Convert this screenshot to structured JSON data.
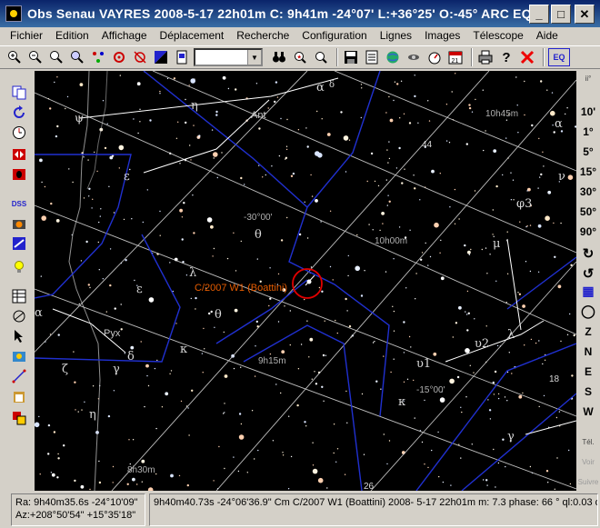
{
  "window": {
    "title": "Obs Senau VAYRES 2008-5-17  22h01m C:  9h41m -24°07' L:+36°25' O:-45° ARC EQ M...",
    "minimize": "_",
    "maximize": "□",
    "close": "✕"
  },
  "menu": [
    "Fichier",
    "Edition",
    "Affichage",
    "Déplacement",
    "Recherche",
    "Configuration",
    "Lignes",
    "Images",
    "Télescope",
    "Aide"
  ],
  "toolbar": {
    "icons": [
      "zoom-in-icon",
      "zoom-out-icon",
      "zoom-fit-icon",
      "find-icon",
      "centre-icon",
      "target-icon",
      "no-target-icon",
      "color-icon",
      "page-icon"
    ],
    "icons_right": [
      "binoculars-icon",
      "search-star-icon",
      "search-object-icon",
      "save-icon",
      "list-icon",
      "globe-icon",
      "satellite-icon",
      "dial-icon",
      "calendar-icon",
      "print-icon",
      "help-icon",
      "exit-icon"
    ],
    "combo_value": "",
    "eq_label": "EQ",
    "help_label": "?",
    "calendar_label": "21"
  },
  "leftbar": {
    "icons": [
      "copy-icon",
      "refresh-icon",
      "clock-icon",
      "flip-icon",
      "bug-icon",
      "dss-icon",
      "camera-icon",
      "telescope-icon",
      "bulb-icon",
      "table-icon",
      "circle-icon",
      "pointer-icon",
      "photo-icon",
      "measure-icon",
      "paste-icon",
      "settings-icon"
    ],
    "dss_label": "DSS"
  },
  "rightbar": {
    "fov": [
      "10'",
      "1°",
      "5°",
      "15°",
      "30°",
      "50°",
      "90°"
    ],
    "directions": [
      "Z",
      "N",
      "E",
      "S",
      "W"
    ],
    "tel_label": "Tél.",
    "voir_label": "Voir",
    "suivre_label": "Suivre",
    "small_label": "ii°"
  },
  "chart": {
    "object_label": "C/2007 W1 (Boattini)",
    "coord_labels": [
      "-30°00'",
      "10h00m",
      "9h15m",
      "-15°00'",
      "10h45m",
      "8h30m"
    ],
    "constellation_labels": [
      "Ant",
      "Pyx"
    ],
    "star_labels": [
      "α",
      "δ",
      "η",
      "ψ",
      "ε",
      "θ",
      "λ",
      "ε",
      "θ",
      "κ",
      "α",
      "δ",
      "γ",
      "ζ",
      "η",
      "μ",
      "φ3",
      "υ2",
      "λ",
      "υ1",
      "κ",
      "γ",
      "α",
      "ν",
      "44",
      "18",
      "26"
    ]
  },
  "status": {
    "ra": "Ra:  9h40m35.6s -24°10'09\"",
    "az": "Az:+208°50'54\" +15°35'18\"",
    "info": "9h40m40.73s -24°06'36.9\"  Cm C/2007 W1 (Boattini) 2008- 5-17  22h01m m:  7.3 phase:  66 ° ql:0.03 o"
  }
}
